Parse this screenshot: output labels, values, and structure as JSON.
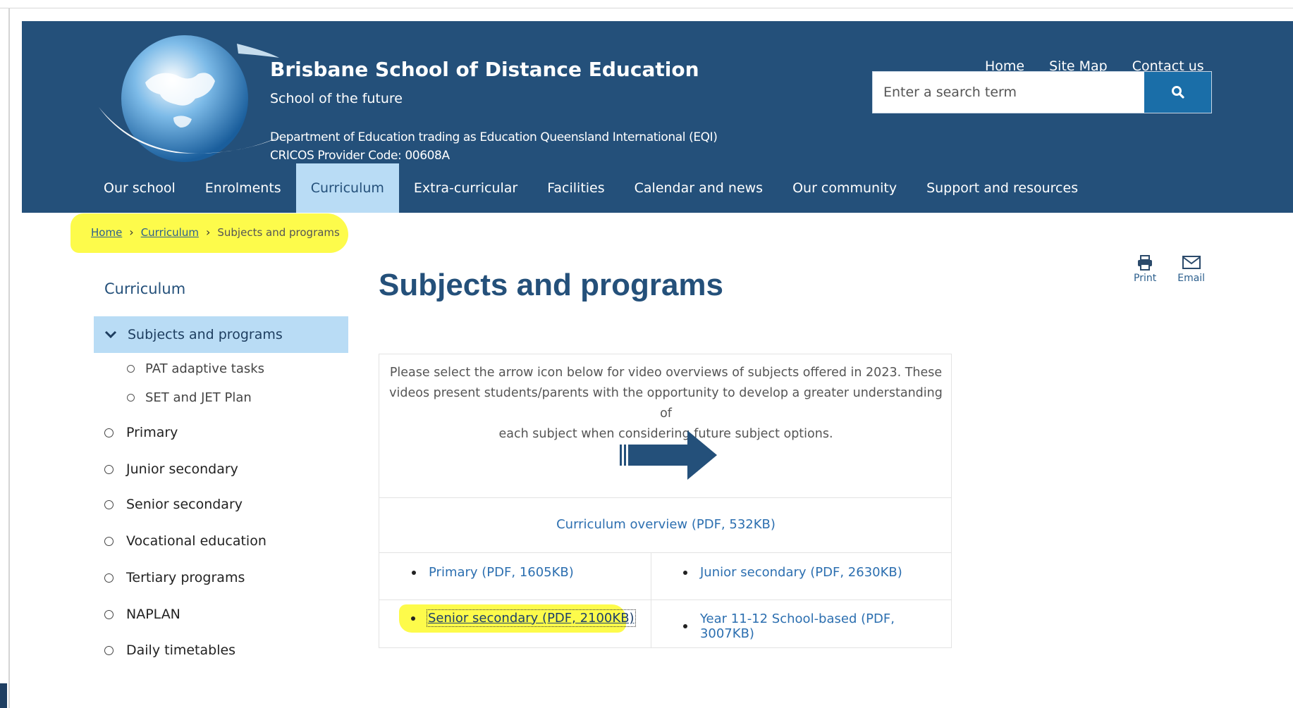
{
  "colors": {
    "header_bg": "#24507a",
    "nav_active_bg": "#b9dcf5",
    "search_button": "#1a6ea8",
    "link": "#2c6fb0",
    "highlight": "#fdfb4b"
  },
  "header": {
    "title": "Brisbane School of Distance Education",
    "tagline": "School of the future",
    "dept_line1": "Department of Education trading as Education Queensland International (EQI)",
    "dept_line2": "CRICOS Provider Code: 00608A",
    "logo_icon": "globe-logo"
  },
  "utility_nav": [
    "Home",
    "Site Map",
    "Contact us"
  ],
  "search": {
    "placeholder": "Enter a search term",
    "button_icon": "search-icon"
  },
  "main_nav": [
    {
      "label": "Our school"
    },
    {
      "label": "Enrolments"
    },
    {
      "label": "Curriculum",
      "active": true
    },
    {
      "label": "Extra-curricular"
    },
    {
      "label": "Facilities"
    },
    {
      "label": "Calendar and news"
    },
    {
      "label": "Our community"
    },
    {
      "label": "Support and resources"
    }
  ],
  "breadcrumb": {
    "items": [
      "Home",
      "Curriculum"
    ],
    "current": "Subjects and programs"
  },
  "sidebar": {
    "title": "Curriculum",
    "active": "Subjects and programs",
    "sub_items": [
      "PAT adaptive tasks",
      "SET and JET Plan"
    ],
    "items": [
      "Primary",
      "Junior secondary",
      "Senior secondary",
      "Vocational education",
      "Tertiary programs",
      "NAPLAN",
      "Daily timetables"
    ]
  },
  "main": {
    "page_title": "Subjects and programs",
    "tools": [
      {
        "label": "Print",
        "icon": "print-icon"
      },
      {
        "label": "Email",
        "icon": "email-icon"
      }
    ],
    "intro_line1": "Please select the arrow icon below for video overviews of subjects offered in 2023. These",
    "intro_line2": "videos present students/parents with the opportunity to develop a greater understanding of",
    "intro_line3": "each subject when considering future subject options.",
    "overview_link": "Curriculum overview (PDF, 532KB)",
    "links": {
      "primary": "Primary (PDF, 1605KB)",
      "junior": "Junior secondary (PDF, 2630KB)",
      "senior": "Senior secondary (PDF, 2100KB)",
      "year1112": "Year 11-12 School-based (PDF, 3007KB)"
    }
  }
}
